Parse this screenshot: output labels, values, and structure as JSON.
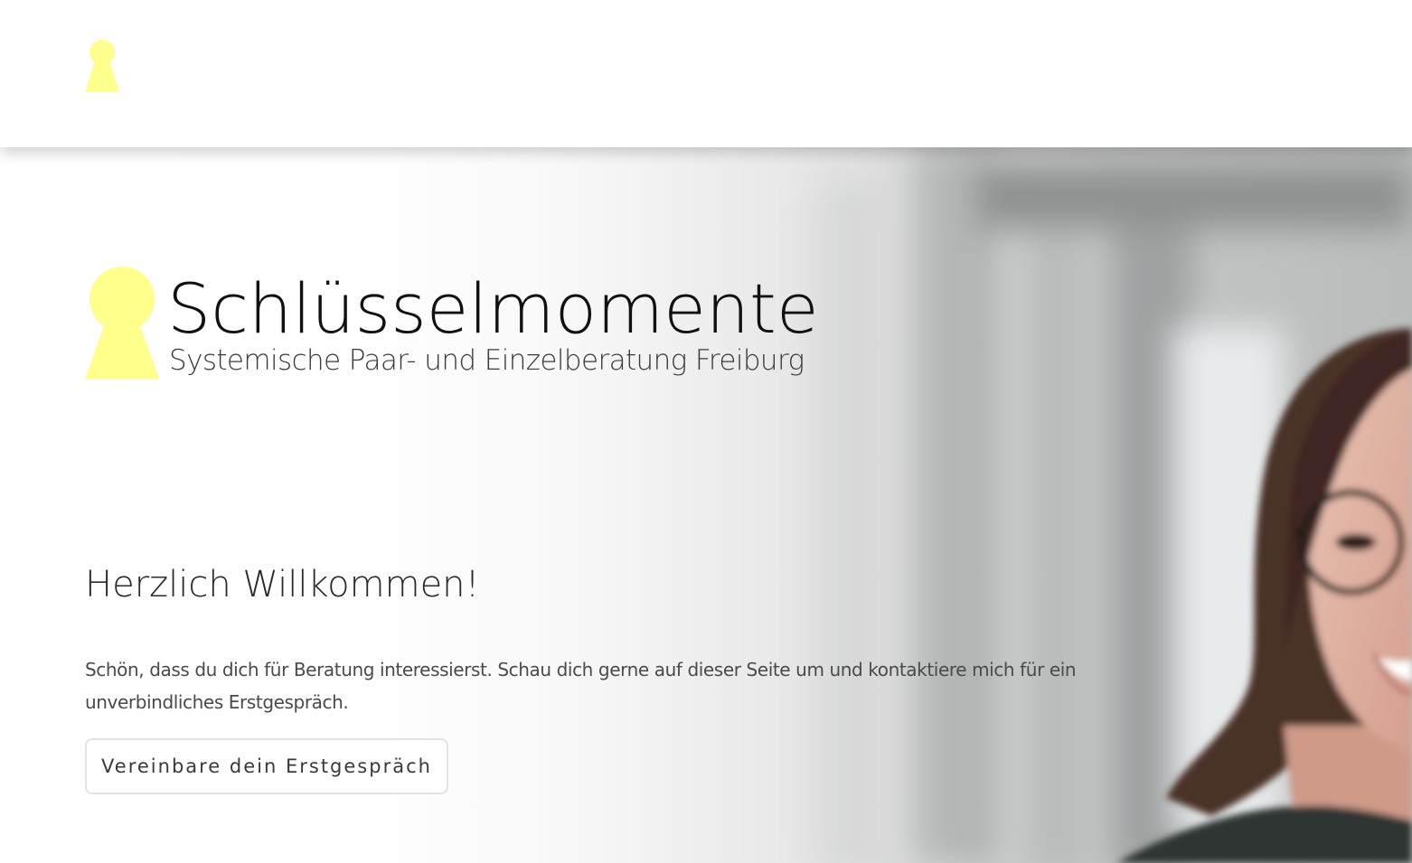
{
  "header": {
    "logo_icon": "keyhole-icon",
    "background": "#ffffff"
  },
  "colors": {
    "accent": "#ffff8c",
    "text_dark": "#111111",
    "text_body": "#4a4a4a"
  },
  "brand": {
    "icon": "keyhole-icon",
    "title": "Schlüsselmomente",
    "subtitle": "Systemische Paar- und Einzelberatung Freiburg"
  },
  "hero": {
    "image": "portrait-photo-woman-with-glasses",
    "heading": "Herzlich Willkommen!",
    "text": "Schön, dass du dich für Beratung interessierst. Schau dich gerne auf dieser Seite um und kontaktiere mich für ein unverbindliches Erstgespräch.",
    "cta_label": "Vereinbare dein Erstgespräch"
  }
}
